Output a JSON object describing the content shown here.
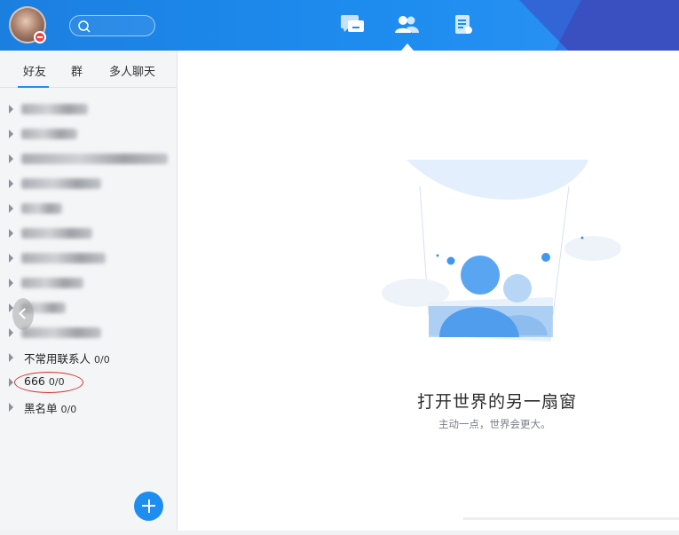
{
  "header": {
    "search_placeholder": "",
    "nav": [
      {
        "name": "messages",
        "icon": "chat-bubbles-icon"
      },
      {
        "name": "contacts",
        "icon": "contacts-icon",
        "active": true
      },
      {
        "name": "notes",
        "icon": "document-icon"
      }
    ],
    "accent": "#1e8df0"
  },
  "sidebar": {
    "tabs": [
      {
        "label": "好友",
        "active": true
      },
      {
        "label": "群"
      },
      {
        "label": "多人聊天"
      }
    ],
    "groups": [
      {
        "label": "不常用联系人",
        "count": "0/0"
      },
      {
        "label": "666",
        "count": "0/0"
      },
      {
        "label": "黑名单",
        "count": "0/0"
      }
    ]
  },
  "main": {
    "title": "打开世界的另一扇窗",
    "subtitle": "主动一点，世界会更大。"
  }
}
